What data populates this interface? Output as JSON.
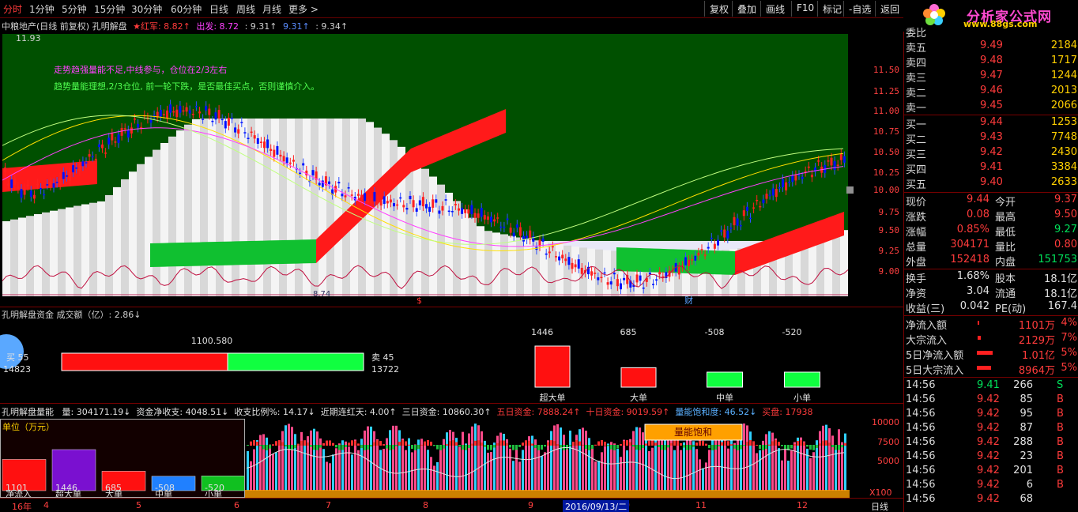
{
  "toolbar": {
    "periods": [
      "分时",
      "1分钟",
      "5分钟",
      "15分钟",
      "30分钟",
      "60分钟",
      "日线",
      "周线",
      "月线",
      "更多 >"
    ],
    "buttons": [
      "复权",
      "叠加",
      "画线",
      "F10",
      "标记",
      "-自选",
      "返回"
    ]
  },
  "logo": {
    "brand": "分析家公式网",
    "site": "www.88gs.com"
  },
  "chart_header": {
    "stock": "中粮地产(日线 前复权) 孔明解盘",
    "red_army": "★红军: 8.82↑",
    "start": "出发: 8.72",
    "v1": ": 9.31↑",
    "v2": "9.31↑",
    "v3": ": 9.34↑",
    "high_mark": "11.93",
    "low_mark": "8.74",
    "note1": "走势趋强量能不足,中线参与，仓位在2/3左右",
    "note2": "趋势量能理想,2/3仓位, 前一轮下跌，是否最佳买点，否则谨慎介入。",
    "event1": "$",
    "event2": "财"
  },
  "price_axis": [
    "11.50",
    "11.25",
    "11.00",
    "10.75",
    "10.50",
    "10.25",
    "10.00",
    "9.75",
    "9.50",
    "9.25",
    "9.00"
  ],
  "mid_panel": {
    "title": "孔明解盘资金 成交额（亿）: 2.86↓",
    "buy_label": "买 55",
    "buy_value": "14823",
    "center_value": "1100.580",
    "sell_label": "卖 45",
    "sell_value": "13722",
    "buy_ratio": 0.55,
    "bars": [
      {
        "label": "超大单",
        "value": "1446",
        "num": 1446
      },
      {
        "label": "大单",
        "value": "685",
        "num": 685
      },
      {
        "label": "中单",
        "value": "-508",
        "num": -508
      },
      {
        "label": "小单",
        "value": "-520",
        "num": -520
      }
    ]
  },
  "vol_panel": {
    "title": "孔明解盘量能",
    "fields": [
      {
        "text": "量: 304171.19↓",
        "color": "#e0e0e0"
      },
      {
        "text": "资金净收支: 4048.51↓",
        "color": "#e0e0e0"
      },
      {
        "text": "收支比例%: 14.17↓",
        "color": "#e0e0e0"
      },
      {
        "text": "近期连红天: 4.00↑",
        "color": "#e0e0e0"
      },
      {
        "text": "三日资金: 10860.30↑",
        "color": "#e0e0e0"
      },
      {
        "text": "五日资金: 7888.24↑",
        "color": "#ff3b3b"
      },
      {
        "text": "十日资金: 9019.59↑",
        "color": "#ff3b3b"
      },
      {
        "text": "量能饱和度: 46.52↓",
        "color": "#5ab0ff"
      },
      {
        "text": "买盘: 17938",
        "color": "#ff3b3b"
      }
    ],
    "unit": "单位（万元）",
    "legend": [
      {
        "label": "净流入",
        "value": "1101",
        "color": "#ff1010",
        "num": 1101
      },
      {
        "label": "超大单",
        "value": "1446",
        "num": 1446,
        "color": "#7a10d0"
      },
      {
        "label": "大单",
        "value": "685",
        "num": 685,
        "color": "#ff1010"
      },
      {
        "label": "中单",
        "value": "-508",
        "num": -508,
        "color": "#2080ff"
      },
      {
        "label": "小单",
        "value": "-520",
        "num": -520,
        "color": "#10c020"
      }
    ],
    "saturation": "量能饱和",
    "axis": [
      "10000",
      "7500",
      "5000"
    ],
    "multiplier": "X100"
  },
  "date_axis": {
    "ticks": [
      {
        "label": "16年",
        "pos": "15"
      },
      {
        "label": "4",
        "pos": "55"
      },
      {
        "label": "5",
        "pos": "172"
      },
      {
        "label": "6",
        "pos": "296"
      },
      {
        "label": "7",
        "pos": "412"
      },
      {
        "label": "8",
        "pos": "535"
      },
      {
        "label": "9",
        "pos": "668"
      },
      {
        "label": "0",
        "pos": "790"
      },
      {
        "label": "11",
        "pos": "880"
      },
      {
        "label": "12",
        "pos": "1008"
      }
    ],
    "cursor_date": "2016/09/13/二",
    "period": "日线"
  },
  "orderbook": {
    "header": "委比",
    "asks": [
      {
        "name": "卖五",
        "price": "9.49",
        "vol": "2184"
      },
      {
        "name": "卖四",
        "price": "9.48",
        "vol": "1717"
      },
      {
        "name": "卖三",
        "price": "9.47",
        "vol": "1244"
      },
      {
        "name": "卖二",
        "price": "9.46",
        "vol": "2013"
      },
      {
        "name": "卖一",
        "price": "9.45",
        "vol": "2066"
      }
    ],
    "bids": [
      {
        "name": "买一",
        "price": "9.44",
        "vol": "1253"
      },
      {
        "name": "买二",
        "price": "9.43",
        "vol": "7748"
      },
      {
        "name": "买三",
        "price": "9.42",
        "vol": "2430"
      },
      {
        "name": "买四",
        "price": "9.41",
        "vol": "3384"
      },
      {
        "name": "买五",
        "price": "9.40",
        "vol": "2633"
      }
    ]
  },
  "quote": [
    {
      "l1": "现价",
      "v1": "9.44",
      "l2": "今开",
      "v2": "9.37"
    },
    {
      "l1": "涨跌",
      "v1": "0.08",
      "l2": "最高",
      "v2": "9.50"
    },
    {
      "l1": "涨幅",
      "v1": "0.85%",
      "l2": "最低",
      "v2": "9.27"
    },
    {
      "l1": "总量",
      "v1": "304171",
      "l2": "量比",
      "v2": "0.80"
    },
    {
      "l1": "外盘",
      "v1": "152418",
      "l2": "内盘",
      "v2": "151753"
    }
  ],
  "quote2": [
    {
      "l1": "换手",
      "v1": "1.68%",
      "l2": "股本",
      "v2": "18.1亿"
    },
    {
      "l1": "净资",
      "v1": "3.04",
      "l2": "流通",
      "v2": "18.1亿"
    },
    {
      "l1": "收益(三)",
      "v1": "0.042",
      "l2": "PE(动)",
      "v2": "167.4"
    }
  ],
  "flows": [
    {
      "name": "净流入额",
      "val": "1101万",
      "pct": "4%"
    },
    {
      "name": "大宗流入",
      "val": "2129万",
      "pct": "7%"
    },
    {
      "name": "5日净流入额",
      "val": "1.01亿",
      "pct": "5%"
    },
    {
      "name": "5日大宗流入",
      "val": "8964万",
      "pct": "5%"
    }
  ],
  "ticks": [
    {
      "time": "14:56",
      "price": "9.41",
      "vol": "266",
      "side": "S"
    },
    {
      "time": "14:56",
      "price": "9.42",
      "vol": "85",
      "side": "B"
    },
    {
      "time": "14:56",
      "price": "9.42",
      "vol": "95",
      "side": "B"
    },
    {
      "time": "14:56",
      "price": "9.42",
      "vol": "87",
      "side": "B"
    },
    {
      "time": "14:56",
      "price": "9.42",
      "vol": "288",
      "side": "B"
    },
    {
      "time": "14:56",
      "price": "9.42",
      "vol": "23",
      "side": "B"
    },
    {
      "time": "14:56",
      "price": "9.42",
      "vol": "201",
      "side": "B"
    },
    {
      "time": "14:56",
      "price": "9.42",
      "vol": "6",
      "side": "B"
    },
    {
      "time": "14:56",
      "price": "9.42",
      "vol": "68",
      "side": ""
    }
  ]
}
